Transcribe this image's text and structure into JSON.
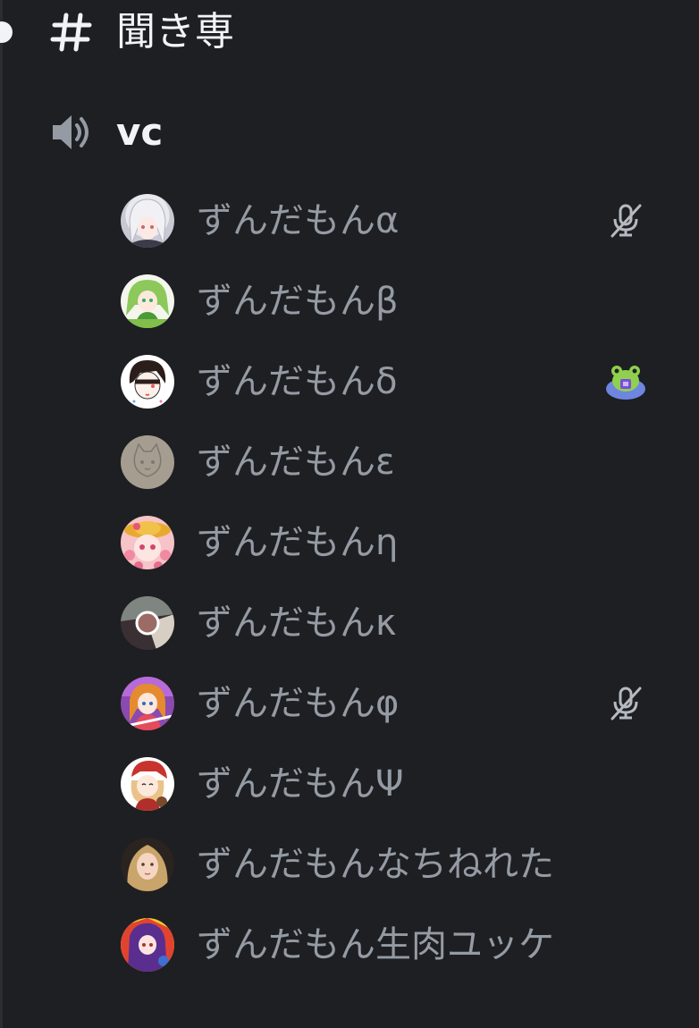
{
  "text_channel": {
    "name": "聞き専",
    "icon": "hashtag-icon"
  },
  "voice_channel": {
    "name": "vc",
    "icon": "speaker-icon"
  },
  "members": [
    {
      "name": "ずんだもんα",
      "icon": "mic-muted-icon",
      "avatar": "avatar-silver-hair"
    },
    {
      "name": "ずんだもんβ",
      "icon": "",
      "avatar": "avatar-green-hair"
    },
    {
      "name": "ずんだもんδ",
      "icon": "frog-emoji-icon",
      "avatar": "avatar-sketch-boy"
    },
    {
      "name": "ずんだもんε",
      "icon": "",
      "avatar": "avatar-gray-sketch"
    },
    {
      "name": "ずんだもんη",
      "icon": "",
      "avatar": "avatar-pink-girl"
    },
    {
      "name": "ずんだもんκ",
      "icon": "",
      "avatar": "avatar-split-circle"
    },
    {
      "name": "ずんだもんφ",
      "icon": "mic-muted-icon",
      "avatar": "avatar-colorful-girl"
    },
    {
      "name": "ずんだもんΨ",
      "icon": "",
      "avatar": "avatar-red-hat-girl"
    },
    {
      "name": "ずんだもんなちねれた",
      "icon": "",
      "avatar": "avatar-blonde-photo"
    },
    {
      "name": "ずんだもん生肉ユッケ",
      "icon": "",
      "avatar": "avatar-purple-hair"
    }
  ],
  "colors": {
    "background": "#1e1f22",
    "channel_text": "#f2f3f5",
    "member_text": "#949ba4",
    "icon_muted": "#b5bac1"
  }
}
